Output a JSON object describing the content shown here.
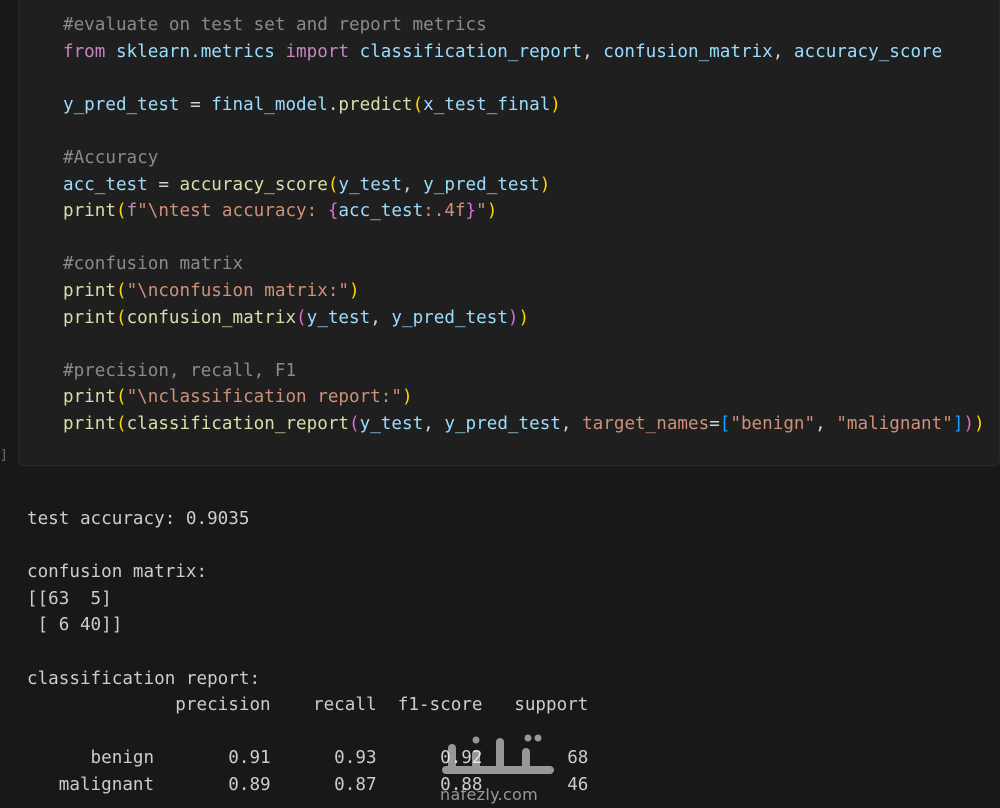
{
  "cell": {
    "marker": "]",
    "lines": [
      {
        "id": "l1",
        "tokens": [
          {
            "t": "#evaluate on test set and report metrics",
            "c": "c dim"
          }
        ]
      },
      {
        "id": "l2",
        "tokens": [
          {
            "t": "from ",
            "c": "k"
          },
          {
            "t": "sklearn.metrics ",
            "c": "v"
          },
          {
            "t": "import ",
            "c": "k"
          },
          {
            "t": "classification_report",
            "c": "v"
          },
          {
            "t": ", ",
            "c": "w"
          },
          {
            "t": "confusion_matrix",
            "c": "v"
          },
          {
            "t": ", ",
            "c": "w"
          },
          {
            "t": "accuracy_score",
            "c": "v"
          }
        ]
      },
      {
        "id": "l3",
        "tokens": []
      },
      {
        "id": "l4",
        "tokens": [
          {
            "t": "y_pred_test ",
            "c": "v"
          },
          {
            "t": "= ",
            "c": "w"
          },
          {
            "t": "final_model",
            "c": "v"
          },
          {
            "t": ".",
            "c": "w"
          },
          {
            "t": "predict",
            "c": "f"
          },
          {
            "t": "(",
            "c": "p"
          },
          {
            "t": "x_test_final",
            "c": "v"
          },
          {
            "t": ")",
            "c": "p"
          }
        ]
      },
      {
        "id": "l5",
        "tokens": []
      },
      {
        "id": "l6",
        "tokens": [
          {
            "t": "#Accuracy",
            "c": "c dim"
          }
        ]
      },
      {
        "id": "l7",
        "tokens": [
          {
            "t": "acc_test ",
            "c": "v"
          },
          {
            "t": "= ",
            "c": "w"
          },
          {
            "t": "accuracy_score",
            "c": "f"
          },
          {
            "t": "(",
            "c": "p"
          },
          {
            "t": "y_test",
            "c": "v"
          },
          {
            "t": ", ",
            "c": "w"
          },
          {
            "t": "y_pred_test",
            "c": "v"
          },
          {
            "t": ")",
            "c": "p"
          }
        ]
      },
      {
        "id": "l8",
        "tokens": [
          {
            "t": "print",
            "c": "f"
          },
          {
            "t": "(",
            "c": "p"
          },
          {
            "t": "f",
            "c": "k"
          },
          {
            "t": "\"\\ntest accuracy: ",
            "c": "s"
          },
          {
            "t": "{",
            "c": "p2"
          },
          {
            "t": "acc_test",
            "c": "v"
          },
          {
            "t": ":.4f",
            "c": "s"
          },
          {
            "t": "}",
            "c": "p2"
          },
          {
            "t": "\"",
            "c": "s"
          },
          {
            "t": ")",
            "c": "p"
          }
        ]
      },
      {
        "id": "l9",
        "tokens": []
      },
      {
        "id": "l10",
        "tokens": [
          {
            "t": "#confusion matrix",
            "c": "c dim"
          }
        ]
      },
      {
        "id": "l11",
        "tokens": [
          {
            "t": "print",
            "c": "f"
          },
          {
            "t": "(",
            "c": "p"
          },
          {
            "t": "\"\\nconfusion matrix:\"",
            "c": "s"
          },
          {
            "t": ")",
            "c": "p"
          }
        ]
      },
      {
        "id": "l12",
        "tokens": [
          {
            "t": "print",
            "c": "f"
          },
          {
            "t": "(",
            "c": "p"
          },
          {
            "t": "confusion_matrix",
            "c": "f"
          },
          {
            "t": "(",
            "c": "p2"
          },
          {
            "t": "y_test",
            "c": "v"
          },
          {
            "t": ", ",
            "c": "w"
          },
          {
            "t": "y_pred_test",
            "c": "v"
          },
          {
            "t": ")",
            "c": "p2"
          },
          {
            "t": ")",
            "c": "p"
          }
        ]
      },
      {
        "id": "l13",
        "tokens": []
      },
      {
        "id": "l14",
        "tokens": [
          {
            "t": "#precision, recall, F1",
            "c": "c dim"
          }
        ]
      },
      {
        "id": "l15",
        "tokens": [
          {
            "t": "print",
            "c": "f"
          },
          {
            "t": "(",
            "c": "p"
          },
          {
            "t": "\"\\nclassification report:\"",
            "c": "s"
          },
          {
            "t": ")",
            "c": "p"
          }
        ]
      },
      {
        "id": "l16",
        "tokens": [
          {
            "t": "print",
            "c": "f"
          },
          {
            "t": "(",
            "c": "p"
          },
          {
            "t": "classification_report",
            "c": "f"
          },
          {
            "t": "(",
            "c": "p2"
          },
          {
            "t": "y_test",
            "c": "v"
          },
          {
            "t": ", ",
            "c": "w"
          },
          {
            "t": "y_pred_test",
            "c": "v"
          },
          {
            "t": ", ",
            "c": "w"
          },
          {
            "t": "target_names",
            "c": "s"
          },
          {
            "t": "=",
            "c": "w"
          },
          {
            "t": "[",
            "c": "p3"
          },
          {
            "t": "\"benign\"",
            "c": "s"
          },
          {
            "t": ", ",
            "c": "w"
          },
          {
            "t": "\"malignant\"",
            "c": "s"
          },
          {
            "t": "]",
            "c": "p3"
          },
          {
            "t": ")",
            "c": "p2"
          },
          {
            "t": ")",
            "c": "p"
          }
        ]
      }
    ]
  },
  "output": {
    "lines": [
      "test accuracy: 0.9035",
      "",
      "confusion matrix:",
      "[[63  5]",
      " [ 6 40]]",
      "",
      "classification report:",
      "              precision    recall  f1-score   support",
      "",
      "      benign       0.91      0.93      0.92        68",
      "   malignant       0.89      0.87      0.88        46"
    ]
  },
  "watermark": {
    "logo_text": "نفذلي",
    "domain": "nafezly.com"
  }
}
